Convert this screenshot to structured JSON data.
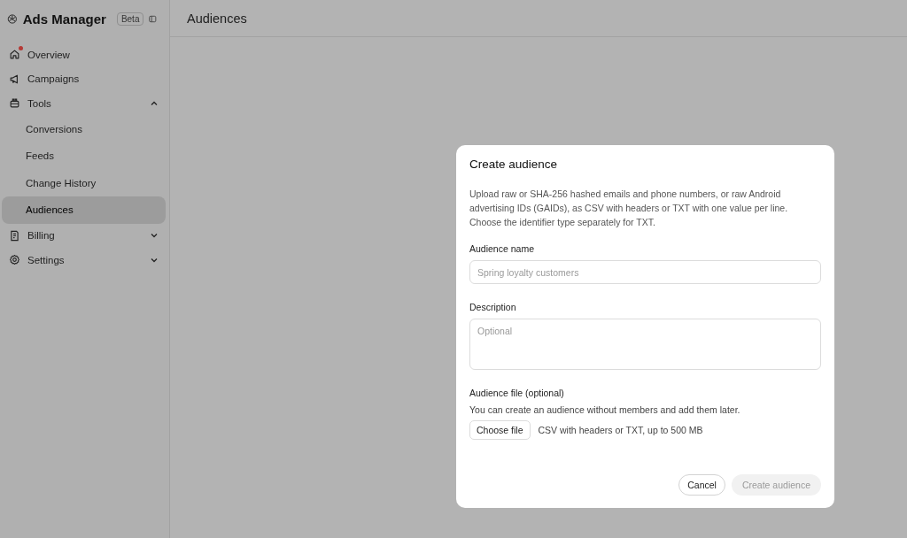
{
  "sidebar": {
    "app_name": "Ads Manager",
    "badge": "Beta",
    "items": [
      {
        "label": "Overview",
        "selected": false,
        "notification": true
      },
      {
        "label": "Campaigns",
        "selected": false,
        "notification": false
      },
      {
        "label": "Tools",
        "selected": false,
        "notification": false,
        "expanded": true,
        "children": [
          {
            "label": "Conversions",
            "selected": false
          },
          {
            "label": "Feeds",
            "selected": false
          },
          {
            "label": "Change History",
            "selected": false
          },
          {
            "label": "Audiences",
            "selected": true
          }
        ]
      },
      {
        "label": "Billing",
        "selected": false,
        "notification": false,
        "expanded": false
      },
      {
        "label": "Settings",
        "selected": false,
        "notification": false,
        "expanded": false
      }
    ]
  },
  "page": {
    "title": "Audiences"
  },
  "dialog": {
    "title": "Create audience",
    "intro": "Upload raw or SHA-256 hashed emails and phone numbers, or raw Android advertising IDs (GAIDs), as CSV with headers or TXT with one value per line. Choose the identifier type separately for TXT.",
    "name_label": "Audience name",
    "name_placeholder": "Spring loyalty customers",
    "description_label": "Description",
    "description_placeholder": "Optional",
    "file_label": "Audience file (optional)",
    "file_help": "You can create an audience without members and add them later.",
    "file_button": "Choose file",
    "file_hint": "CSV with headers or TXT, up to 500 MB",
    "cancel": "Cancel",
    "submit": {
      "label": "Create audience",
      "disabled": true
    }
  }
}
